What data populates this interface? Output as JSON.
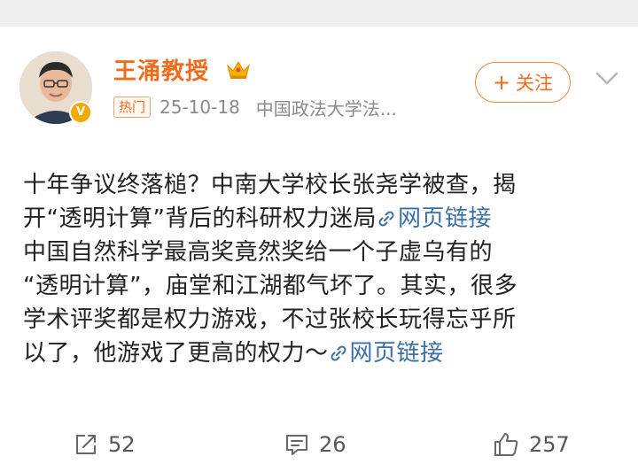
{
  "post": {
    "author": {
      "name": "王涌教授",
      "tag": "热门",
      "date": "25-10-18",
      "source": "中国政法大学法..."
    },
    "follow_label": "关注",
    "content": {
      "line1": "十年争议终落槌？中南大学校长张尧学被查，揭",
      "line2_text": "开“透明计算”背后的科研权力迷局",
      "line2_link": "网页链接",
      "line3": "中国自然科学最高奖竟然奖给一个子虚乌有的",
      "line4": "“透明计算”，庙堂和江湖都气坏了。其实，很多",
      "line5": "学术评奖都是权力游戏，不过张校长玩得忘乎所",
      "line6_text": "以了，他游戏了更高的权力～",
      "line6_link": "网页链接"
    },
    "actions": {
      "reposts": "52",
      "comments": "26",
      "likes": "257"
    }
  },
  "icons": {
    "crown": "crown-icon",
    "verified": "verified-badge-icon",
    "chevron": "chevron-down-icon",
    "link": "link-icon",
    "repost": "repost-icon",
    "comment": "comment-icon",
    "like": "thumbs-up-icon"
  },
  "colors": {
    "brand_orange": "#f26b1d",
    "link_blue": "#3b6ea5",
    "text": "#222222",
    "meta_gray": "#8a8a8a"
  }
}
